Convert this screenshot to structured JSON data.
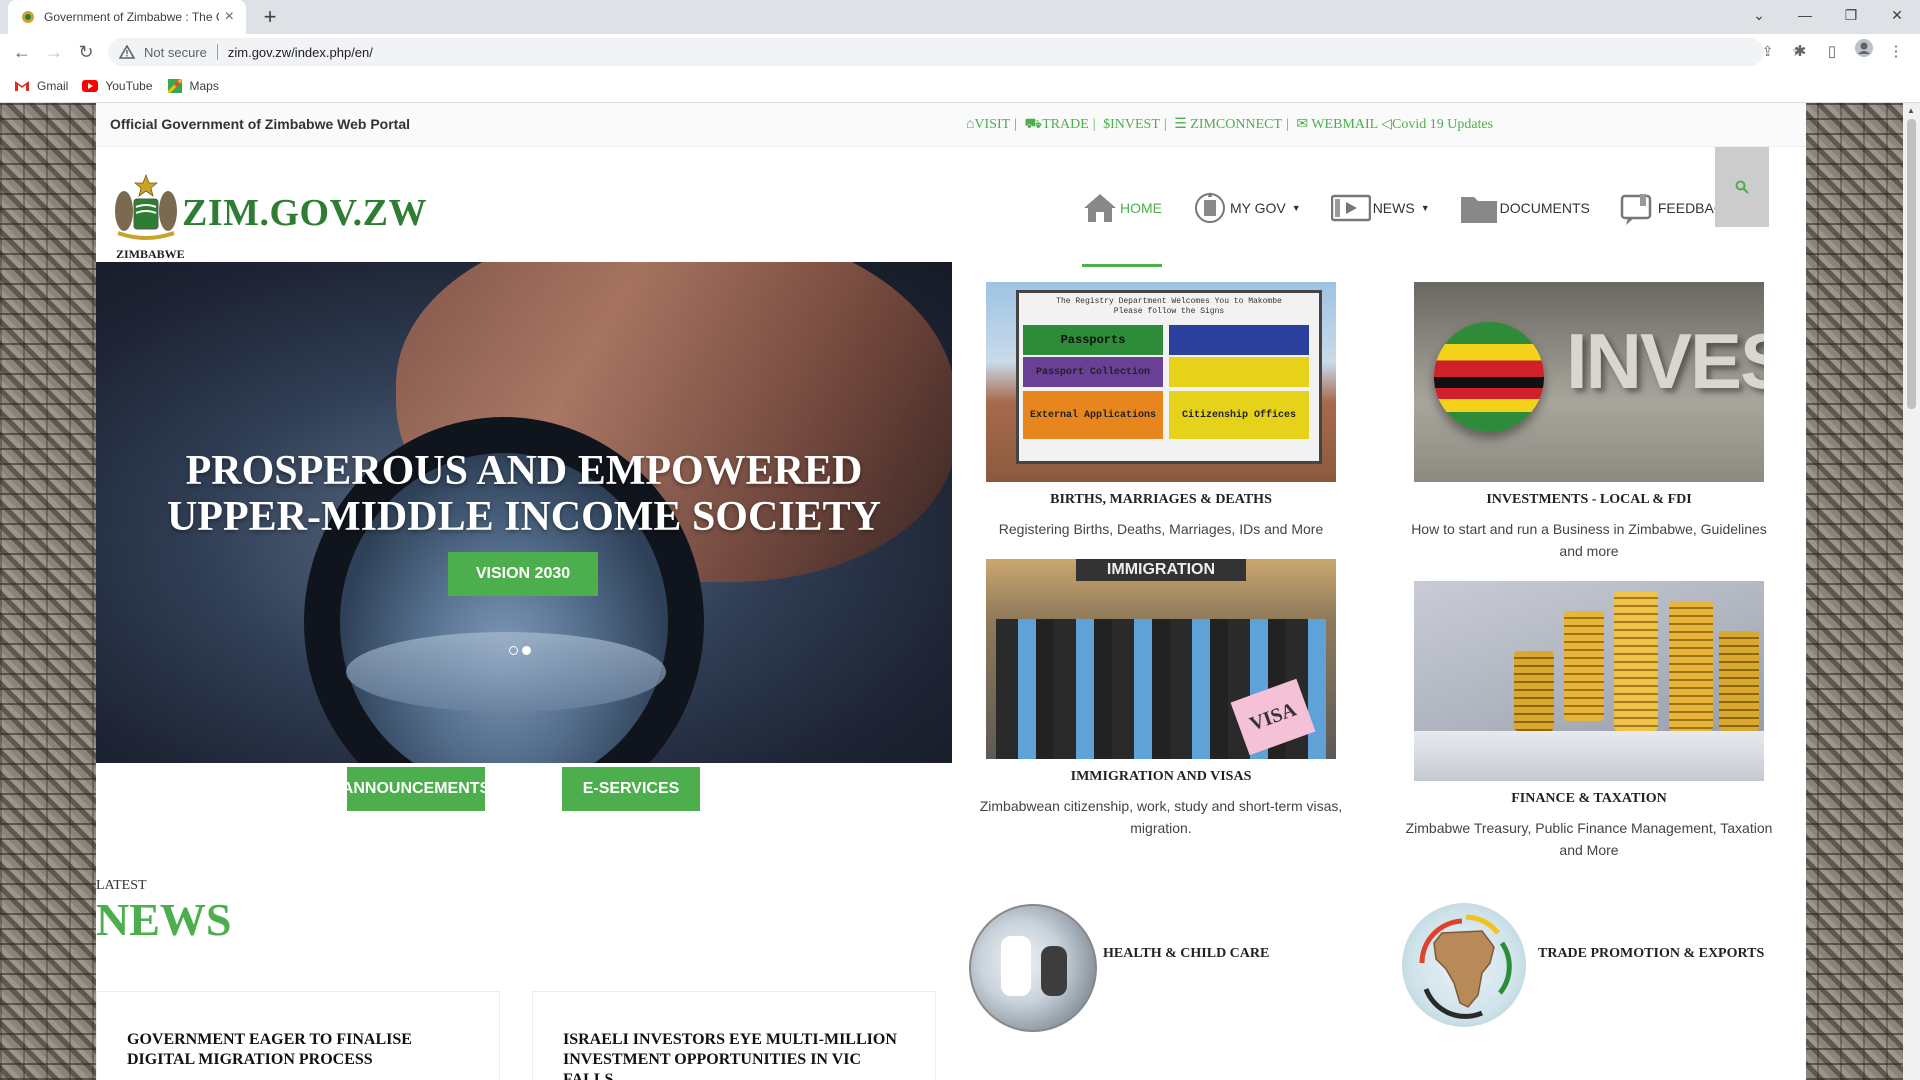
{
  "browser": {
    "tab_title": "Government of Zimbabwe : The C",
    "new_tab": "+",
    "not_secure": "Not secure",
    "url": "zim.gov.zw/index.php/en/",
    "bookmarks": [
      "Gmail",
      "YouTube",
      "Maps"
    ]
  },
  "site": {
    "portal_title": "Official Government of Zimbabwe Web Portal",
    "top_links": [
      "VISIT",
      "TRADE",
      "$INVEST",
      "ZIMCONNECT",
      "WEBMAIL",
      "Covid 19 Updates"
    ],
    "logo_title": "ZIM.GOV.ZW",
    "logo_sub": "ZIMBABWE",
    "nav": [
      "HOME",
      "MY GOV",
      "NEWS",
      "DOCUMENTS",
      "FEEDBACK"
    ],
    "hero": {
      "title_line1": "PROSPEROUS AND EMPOWERED",
      "title_line2": "UPPER-MIDDLE INCOME SOCIETY",
      "button": "VISION 2030"
    },
    "buttons": {
      "announcements": "ANNOUNCEMENTS",
      "eservices": "E-SERVICES"
    },
    "cards": [
      {
        "title": "BIRTHS, MARRIAGES & DEATHS",
        "desc": "Registering Births, Deaths, Marriages, IDs and More"
      },
      {
        "title": "INVESTMENTS - LOCAL & FDI",
        "desc": "How to start and run a Business in Zimbabwe, Guidelines and more"
      },
      {
        "title": "IMMIGRATION AND VISAS",
        "desc": "Zimbabwean citizenship, work, study and short-term visas, migration."
      },
      {
        "title": "FINANCE & TAXATION",
        "desc": "Zimbabwe Treasury, Public Finance Management, Taxation and More"
      }
    ],
    "sign_text": {
      "welcome": "The Registry Department Welcomes You to Makombe",
      "follow": "Please follow the Signs",
      "passports": "Passports",
      "collection": "Passport Collection",
      "external": "External Applications",
      "citizenship": "Citizenship Offices"
    },
    "invest_word": "INVEST",
    "immigration_sign": "IMMIGRATION",
    "visa_stamp": "VISA",
    "latest": "LATEST",
    "news_heading": "NEWS",
    "news": [
      "GOVERNMENT EAGER TO FINALISE DIGITAL MIGRATION PROCESS",
      "ISRAELI INVESTORS EYE MULTI-MILLION INVESTMENT OPPORTUNITIES IN VIC FALLS"
    ],
    "circles": [
      "HEALTH & CHILD CARE",
      "TRADE PROMOTION & EXPORTS"
    ]
  },
  "colors": {
    "brand_green": "#4cae4c",
    "logo_green": "#2e7d32"
  }
}
